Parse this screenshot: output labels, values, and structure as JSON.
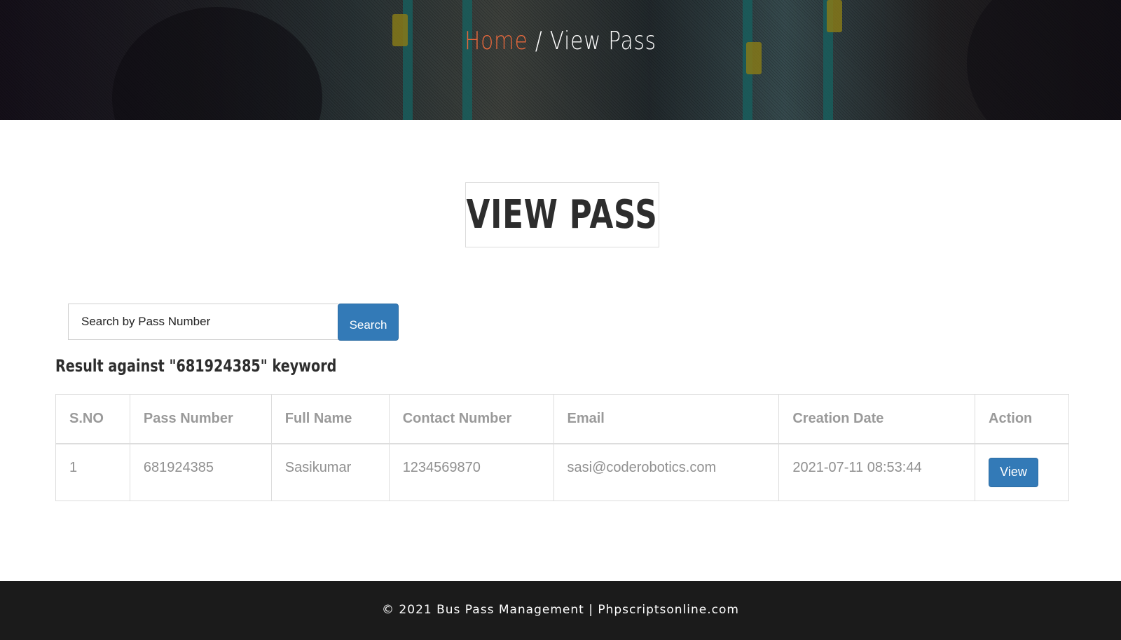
{
  "breadcrumb": {
    "home": "Home",
    "separator": " / ",
    "current": "View Pass"
  },
  "page_title": "VIEW PASS",
  "search": {
    "placeholder": "Search by Pass Number",
    "value": "",
    "button_label": "Search"
  },
  "result_heading": "Result against \"681924385\" keyword",
  "table": {
    "headers": [
      "S.NO",
      "Pass Number",
      "Full Name",
      "Contact Number",
      "Email",
      "Creation Date",
      "Action"
    ],
    "rows": [
      {
        "sno": "1",
        "pass_number": "681924385",
        "full_name": "Sasikumar",
        "contact_number": "1234569870",
        "email": "sasi@coderobotics.com",
        "creation_date": "2021-07-11 08:53:44",
        "action_label": "View"
      }
    ]
  },
  "footer": {
    "text": "© 2021 Bus Pass Management | Phpscriptsonline.com"
  },
  "colors": {
    "accent_orange": "#e7683c",
    "button_blue": "#337ab7",
    "footer_bg": "#1b1b1b"
  }
}
